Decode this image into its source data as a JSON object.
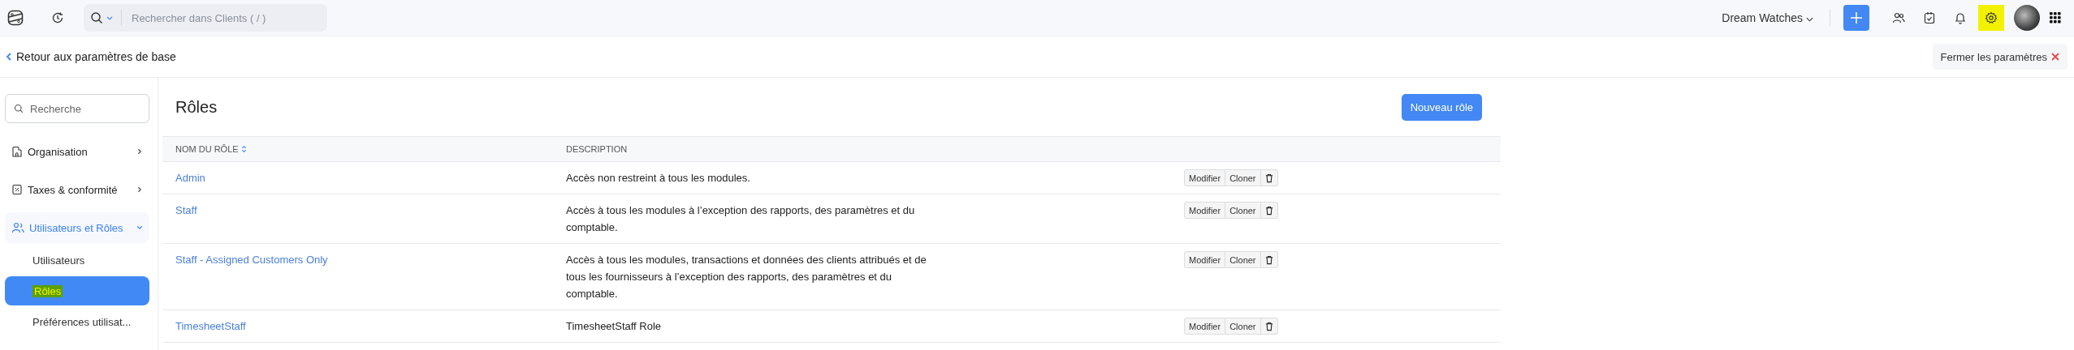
{
  "topbar": {
    "search_placeholder": "Rechercher dans Clients ( / )",
    "organization": "Dream Watches",
    "icons": [
      {
        "highlighted": false
      },
      {
        "highlighted": false
      },
      {
        "highlighted": false
      },
      {
        "highlighted": true
      }
    ]
  },
  "back_link": "Retour aux paramètres de base",
  "close_settings": "Fermer les paramètres",
  "sidebar": {
    "search_placeholder": "Recherche",
    "items": [
      {
        "label": "Organisation",
        "expanded": false
      },
      {
        "label": "Taxes & conformité",
        "expanded": false
      },
      {
        "label": "Utilisateurs et Rôles",
        "expanded": true,
        "children": [
          {
            "label": "Utilisateurs",
            "selected": false,
            "highlighted": false
          },
          {
            "label": "Rôles",
            "selected": true,
            "highlighted": true
          },
          {
            "label": "Préférences utilisat...",
            "selected": false,
            "highlighted": false
          }
        ]
      }
    ]
  },
  "page_title": "Rôles",
  "new_button": "Nouveau rôle",
  "table": {
    "columns": [
      {
        "label": "NOM DU RÔLE",
        "sortable": true
      },
      {
        "label": "DESCRIPTION",
        "sortable": false
      }
    ],
    "rows": [
      {
        "name": "Admin",
        "description": "Accès non restreint à tous les modules.",
        "actions": [
          "Modifier",
          "Cloner"
        ]
      },
      {
        "name": "Staff",
        "description": "Accès à tous les modules à l’exception des rapports, des paramètres et du comptable.",
        "actions": [
          "Modifier",
          "Cloner"
        ]
      },
      {
        "name": "Staff - Assigned Customers Only",
        "description": "Accès à tous les modules, transactions et données des clients attribués et de tous les fournisseurs à l’exception des rapports, des paramètres et du comptable.",
        "actions": [
          "Modifier",
          "Cloner"
        ]
      },
      {
        "name": "TimesheetStaff",
        "description": "TimesheetStaff Role",
        "actions": [
          "Modifier",
          "Cloner"
        ]
      }
    ]
  }
}
